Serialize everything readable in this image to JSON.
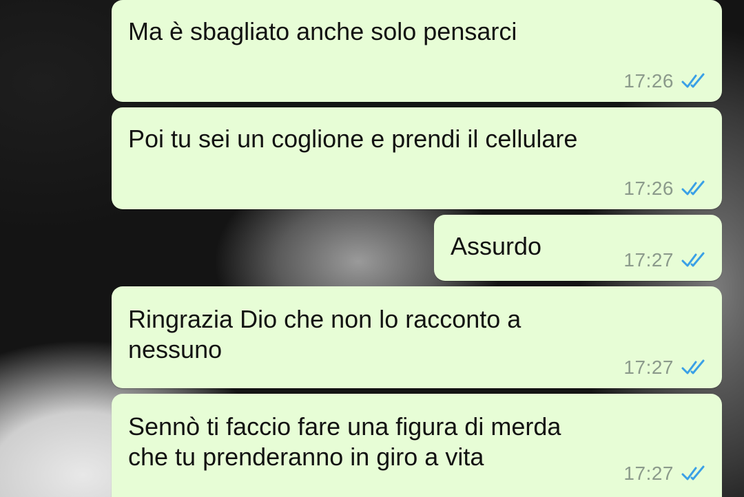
{
  "messages": [
    {
      "text": "Ma è sbagliato anche solo pensarci",
      "time": "17:26",
      "status_icon": "double-check-read-icon"
    },
    {
      "text": "Poi tu sei un coglione e prendi il cellulare",
      "time": "17:26",
      "status_icon": "double-check-read-icon"
    },
    {
      "text": "Assurdo",
      "time": "17:27",
      "status_icon": "double-check-read-icon"
    },
    {
      "text": "Ringrazia Dio che non lo racconto a\nnessuno",
      "time": "17:27",
      "status_icon": "double-check-read-icon"
    },
    {
      "text": "Sennò ti faccio fare una figura di merda\nche tu prenderanno in giro a vita",
      "time": "17:27",
      "status_icon": "double-check-read-icon"
    }
  ],
  "colors": {
    "bubble": "#e7fdd6",
    "read_ticks": "#3aa0e6",
    "time": "#8b9a8b"
  }
}
